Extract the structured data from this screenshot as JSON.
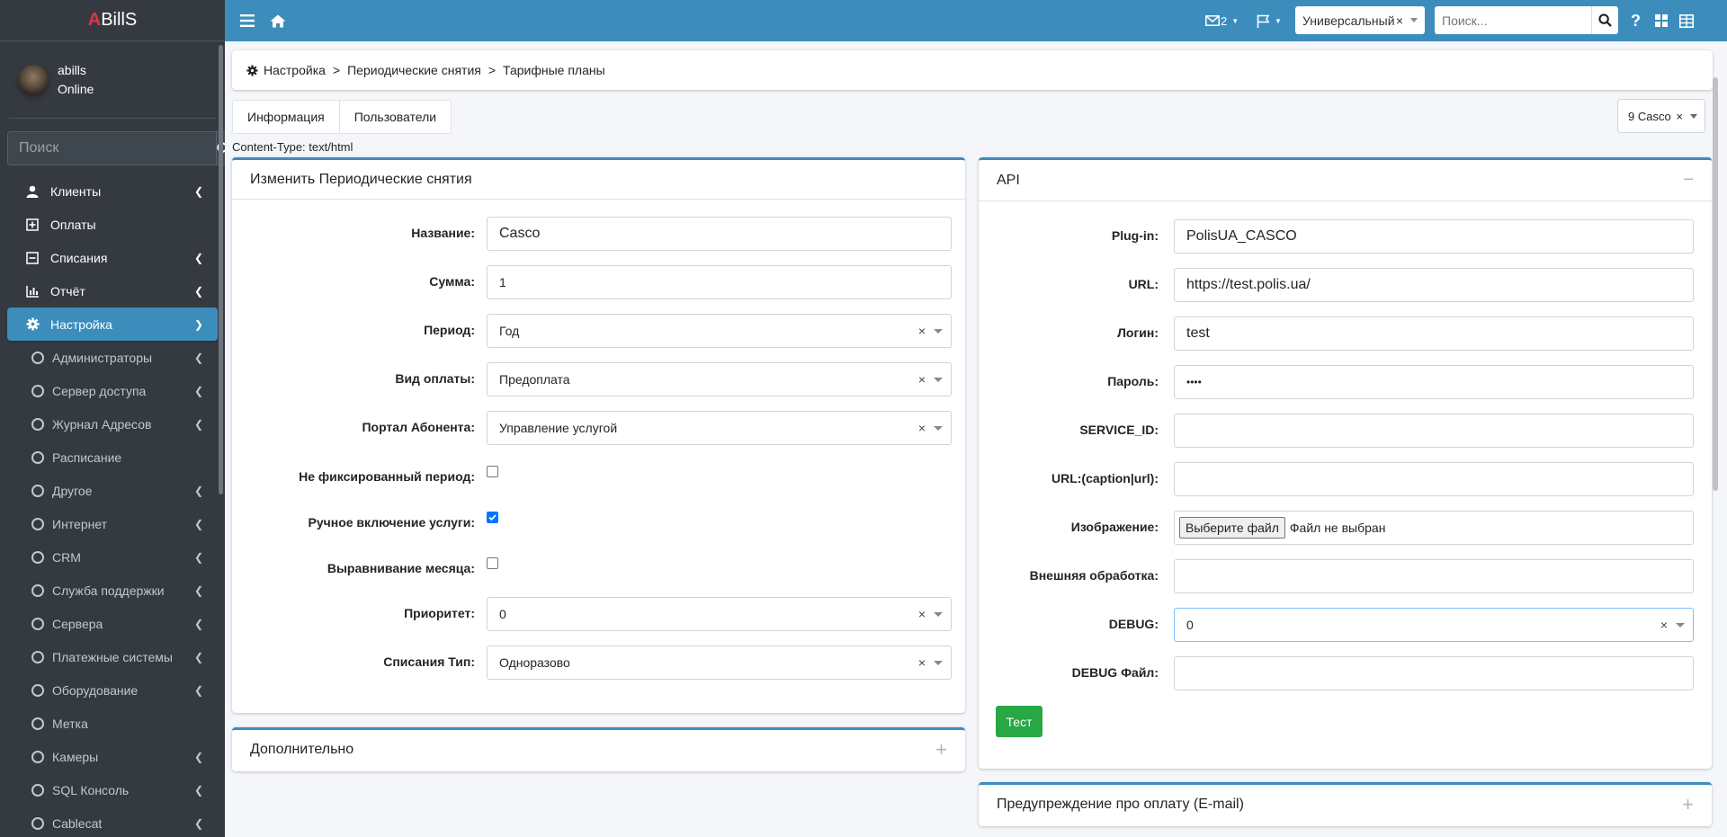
{
  "brand": {
    "a": "A",
    "rest": "BillS"
  },
  "user": {
    "name": "abills",
    "status": "Online"
  },
  "sidebar_search": {
    "placeholder": "Поиск"
  },
  "nav": {
    "clients": "Клиенты",
    "payments": "Оплаты",
    "fees": "Списания",
    "report": "Отчёт",
    "settings": "Настройка",
    "subs": [
      "Администраторы",
      "Сервер доступа",
      "Журнал Адресов",
      "Расписание",
      "Другое",
      "Интернет",
      "CRM",
      "Служба поддержки",
      "Сервера",
      "Платежные системы",
      "Оборудование",
      "Метка",
      "Камеры",
      "SQL Консоль",
      "Cablecat"
    ]
  },
  "topbar": {
    "mail_count": "2",
    "select_value": "Универсальный",
    "search_placeholder": "Поиск..."
  },
  "breadcrumb": [
    "Настройка",
    "Периодические снятия",
    "Тарифные планы"
  ],
  "tabs": [
    "Информация",
    "Пользователи"
  ],
  "content_type": "Content-Type: text/html",
  "right_select": "9 Casco",
  "left_card": {
    "title": "Изменить Периодические снятия",
    "fields": {
      "name_label": "Название:",
      "name_value": "Casco",
      "sum_label": "Сумма:",
      "sum_value": "1",
      "period_label": "Период:",
      "period_value": "Год",
      "paytype_label": "Вид оплаты:",
      "paytype_value": "Предоплата",
      "portal_label": "Портал Абонента:",
      "portal_value": "Управление услугой",
      "nonfixed_label": "Не фиксированный период:",
      "nonfixed_checked": false,
      "manual_label": "Ручное включение услуги:",
      "manual_checked": true,
      "align_label": "Выравнивание месяца:",
      "align_checked": false,
      "priority_label": "Приоритет:",
      "priority_value": "0",
      "feetype_label": "Списания Тип:",
      "feetype_value": "Одноразово"
    }
  },
  "extra_card": {
    "title": "Дополнительно"
  },
  "api_card": {
    "title": "API",
    "plugin_label": "Plug-in:",
    "plugin_value": "PolisUA_CASCO",
    "url_label": "URL:",
    "url_value": "https://test.polis.ua/",
    "login_label": "Логин:",
    "login_value": "test",
    "password_label": "Пароль:",
    "password_value": "••••",
    "service_label": "SERVICE_ID:",
    "urlcap_label": "URL:(caption|url):",
    "image_label": "Изображение:",
    "file_button": "Выберите файл",
    "file_none": "Файл не выбран",
    "ext_label": "Внешняя обработка:",
    "debug_label": "DEBUG:",
    "debug_value": "0",
    "debugfile_label": "DEBUG Файл:",
    "test_button": "Тест"
  },
  "warn_card": {
    "title": "Предупреждение про оплату (E-mail)"
  }
}
